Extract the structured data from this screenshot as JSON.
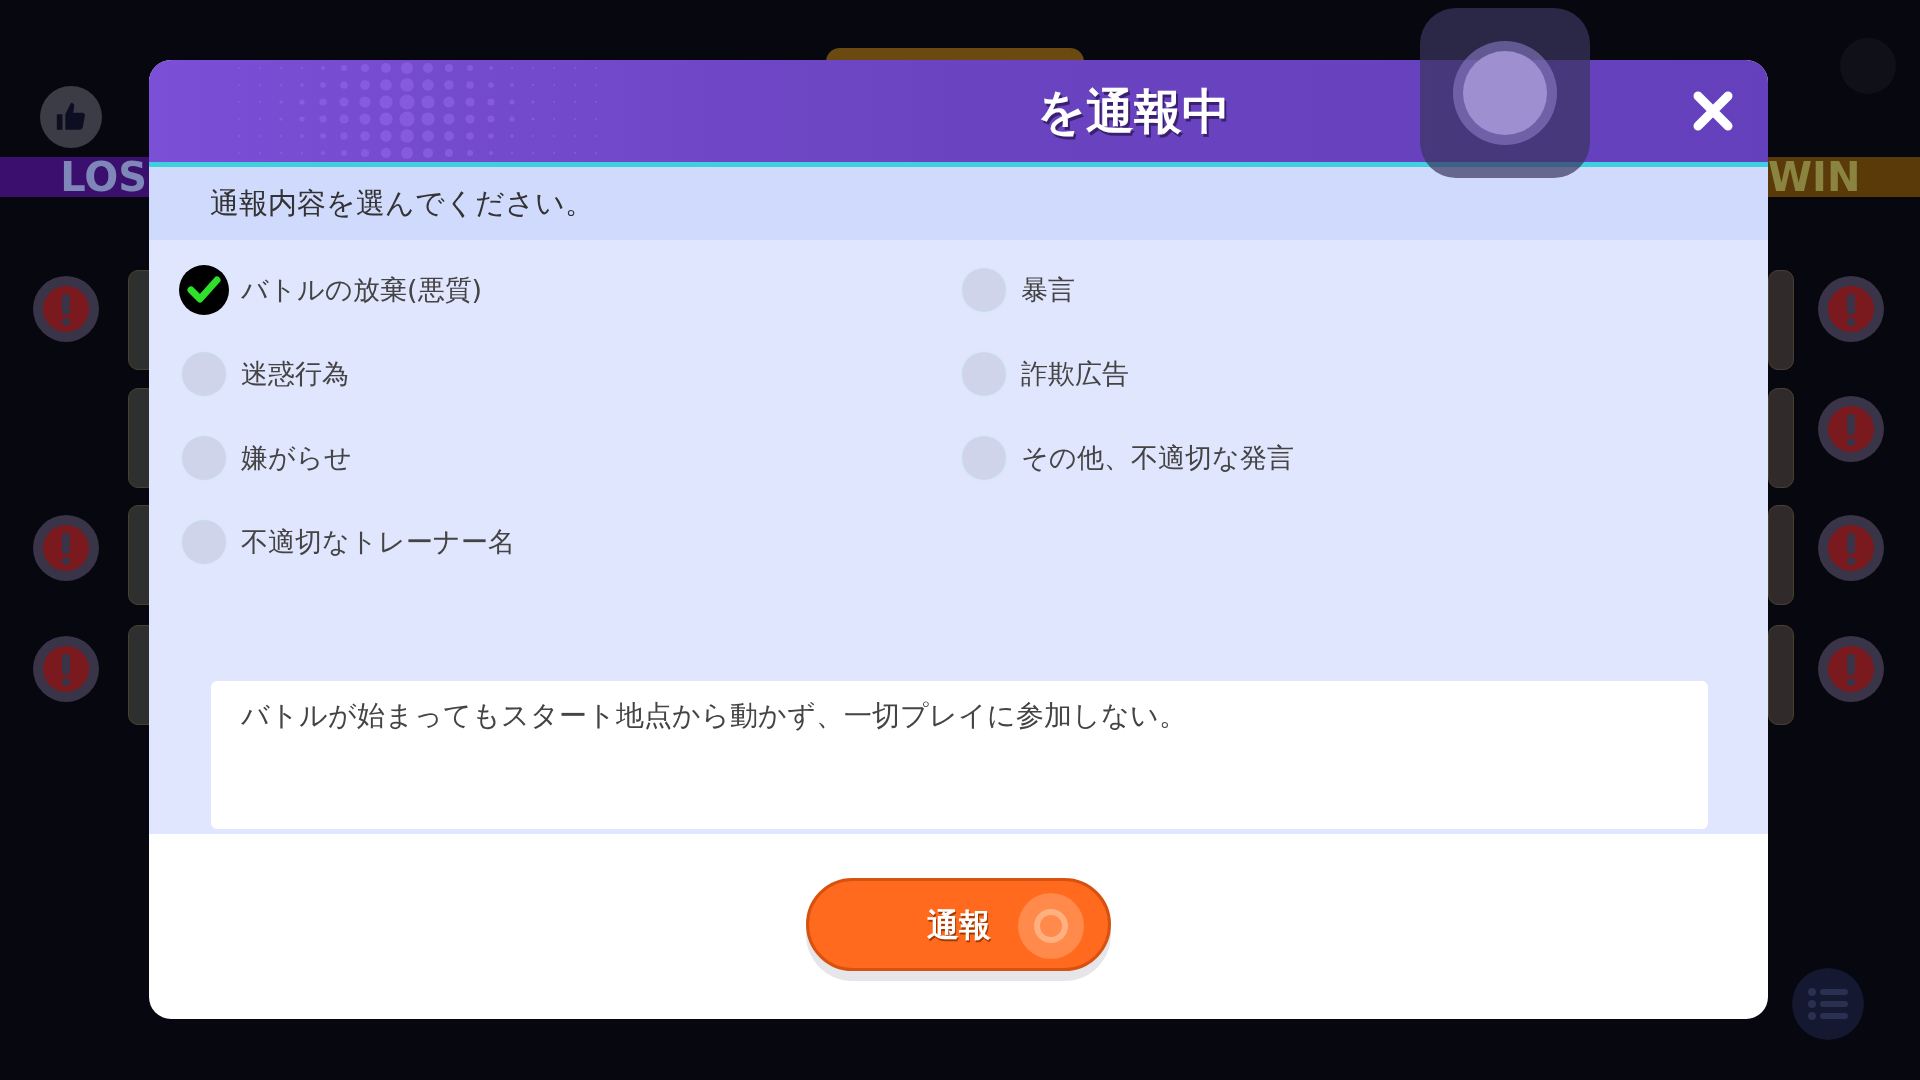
{
  "background": {
    "left_label": "LOS",
    "right_label": "WIN"
  },
  "dialog": {
    "title": "を通報中",
    "instruction": "通報内容を選んでください。",
    "options": [
      {
        "label": "バトルの放棄(悪質)",
        "selected": true
      },
      {
        "label": "暴言",
        "selected": false
      },
      {
        "label": "迷惑行為",
        "selected": false
      },
      {
        "label": "詐欺広告",
        "selected": false
      },
      {
        "label": "嫌がらせ",
        "selected": false
      },
      {
        "label": "その他、不適切な発言",
        "selected": false
      },
      {
        "label": "不適切なトレーナー名",
        "selected": false
      }
    ],
    "comment": "バトルが始まってもスタート地点から動かず、一切プレイに参加しない。",
    "submit": "通報"
  }
}
